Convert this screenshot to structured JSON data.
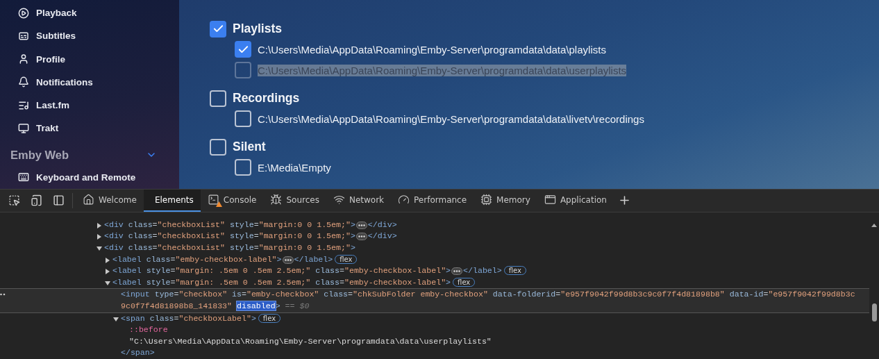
{
  "sidebar": {
    "items": [
      {
        "kind": "playback",
        "label": "Playback"
      },
      {
        "kind": "subtitles",
        "label": "Subtitles"
      },
      {
        "kind": "profile",
        "label": "Profile"
      },
      {
        "kind": "notifications",
        "label": "Notifications"
      },
      {
        "kind": "lastfm",
        "label": "Last.fm"
      },
      {
        "kind": "trakt",
        "label": "Trakt"
      }
    ],
    "section": {
      "title": "Emby Web",
      "expanded": true,
      "items": [
        {
          "kind": "keyboard",
          "label": "Keyboard and Remote"
        }
      ]
    }
  },
  "folders": [
    {
      "name": "Playlists",
      "checked": true,
      "subfolders": [
        {
          "path": "C:\\Users\\Media\\AppData\\Roaming\\Emby-Server\\programdata\\data\\playlists",
          "checked": true,
          "disabled": false,
          "highlighted": false
        },
        {
          "path": "C:\\Users\\Media\\AppData\\Roaming\\Emby-Server\\programdata\\data\\userplaylists",
          "checked": false,
          "disabled": true,
          "highlighted": true
        }
      ]
    },
    {
      "name": "Recordings",
      "checked": false,
      "subfolders": [
        {
          "path": "C:\\Users\\Media\\AppData\\Roaming\\Emby-Server\\programdata\\data\\livetv\\recordings",
          "checked": false,
          "disabled": false,
          "highlighted": false
        }
      ]
    },
    {
      "name": "Silent",
      "checked": false,
      "subfolders": [
        {
          "path": "E:\\Media\\Empty",
          "checked": false,
          "disabled": false,
          "highlighted": false
        }
      ]
    }
  ],
  "devtools": {
    "tabs": [
      {
        "kind": "welcome",
        "label": "Welcome",
        "selected": false,
        "warning": false
      },
      {
        "kind": "elements",
        "label": "Elements",
        "selected": true,
        "warning": false
      },
      {
        "kind": "console",
        "label": "Console",
        "selected": false,
        "warning": true
      },
      {
        "kind": "sources",
        "label": "Sources",
        "selected": false,
        "warning": false
      },
      {
        "kind": "network",
        "label": "Network",
        "selected": false,
        "warning": false
      },
      {
        "kind": "performance",
        "label": "Performance",
        "selected": false,
        "warning": false
      },
      {
        "kind": "memory",
        "label": "Memory",
        "selected": false,
        "warning": false
      },
      {
        "kind": "application",
        "label": "Application",
        "selected": false,
        "warning": false
      }
    ],
    "dom_tree": [
      {
        "expanded": false,
        "selected": false,
        "open": [
          {
            "kind": "tag",
            "text": "<div"
          },
          {
            "kind": "attr",
            "text": " class"
          },
          {
            "kind": "punct",
            "text": "="
          },
          {
            "kind": "value",
            "text": "\"checkboxList\""
          },
          {
            "kind": "attr",
            "text": " style"
          },
          {
            "kind": "punct",
            "text": "="
          },
          {
            "kind": "value",
            "text": "\"margin:0 0 1.5em;\""
          },
          {
            "kind": "tag",
            "text": ">"
          }
        ],
        "close": [
          {
            "kind": "tag",
            "text": "</div>"
          }
        ]
      },
      {
        "expanded": false,
        "selected": false,
        "open": [
          {
            "kind": "tag",
            "text": "<div"
          },
          {
            "kind": "attr",
            "text": " class"
          },
          {
            "kind": "punct",
            "text": "="
          },
          {
            "kind": "value",
            "text": "\"checkboxList\""
          },
          {
            "kind": "attr",
            "text": " style"
          },
          {
            "kind": "punct",
            "text": "="
          },
          {
            "kind": "value",
            "text": "\"margin:0 0 1.5em;\""
          },
          {
            "kind": "tag",
            "text": ">"
          }
        ],
        "close": [
          {
            "kind": "tag",
            "text": "</div>"
          }
        ]
      },
      {
        "expanded": true,
        "selected": false,
        "open": [
          {
            "kind": "tag",
            "text": "<div"
          },
          {
            "kind": "attr",
            "text": " class"
          },
          {
            "kind": "punct",
            "text": "="
          },
          {
            "kind": "value",
            "text": "\"checkboxList\""
          },
          {
            "kind": "attr",
            "text": " style"
          },
          {
            "kind": "punct",
            "text": "="
          },
          {
            "kind": "value",
            "text": "\"margin:0 0 1.5em;\""
          },
          {
            "kind": "tag",
            "text": ">"
          }
        ],
        "children": [
          {
            "expanded": false,
            "selected": false,
            "badge": "flex",
            "open": [
              {
                "kind": "tag",
                "text": "<label"
              },
              {
                "kind": "attr",
                "text": " class"
              },
              {
                "kind": "punct",
                "text": "="
              },
              {
                "kind": "value",
                "text": "\"emby-checkbox-label\""
              },
              {
                "kind": "tag",
                "text": ">"
              }
            ],
            "close": [
              {
                "kind": "tag",
                "text": "</label>"
              }
            ]
          },
          {
            "expanded": false,
            "selected": false,
            "badge": "flex",
            "open": [
              {
                "kind": "tag",
                "text": "<label"
              },
              {
                "kind": "attr",
                "text": " style"
              },
              {
                "kind": "punct",
                "text": "="
              },
              {
                "kind": "value",
                "text": "\"margin: .5em 0 .5em 2.5em;\""
              },
              {
                "kind": "attr",
                "text": " class"
              },
              {
                "kind": "punct",
                "text": "="
              },
              {
                "kind": "value",
                "text": "\"emby-checkbox-label\""
              },
              {
                "kind": "tag",
                "text": ">"
              }
            ],
            "close": [
              {
                "kind": "tag",
                "text": "</label>"
              }
            ]
          },
          {
            "expanded": true,
            "selected": false,
            "badge": "flex",
            "open": [
              {
                "kind": "tag",
                "text": "<label"
              },
              {
                "kind": "attr",
                "text": " style"
              },
              {
                "kind": "punct",
                "text": "="
              },
              {
                "kind": "value",
                "text": "\"margin: .5em 0 .5em 2.5em;\""
              },
              {
                "kind": "attr",
                "text": " class"
              },
              {
                "kind": "punct",
                "text": "="
              },
              {
                "kind": "value",
                "text": "\"emby-checkbox-label\""
              },
              {
                "kind": "tag",
                "text": ">"
              }
            ],
            "children": [
              {
                "selected": true,
                "open": [
                  {
                    "kind": "tag",
                    "text": "<input"
                  },
                  {
                    "kind": "attr",
                    "text": " type"
                  },
                  {
                    "kind": "punct",
                    "text": "="
                  },
                  {
                    "kind": "value",
                    "text": "\"checkbox\""
                  },
                  {
                    "kind": "attr",
                    "text": " is"
                  },
                  {
                    "kind": "punct",
                    "text": "="
                  },
                  {
                    "kind": "value",
                    "text": "\"emby-checkbox\""
                  },
                  {
                    "kind": "attr",
                    "text": " class"
                  },
                  {
                    "kind": "punct",
                    "text": "="
                  },
                  {
                    "kind": "value",
                    "text": "\"chkSubFolder emby-checkbox\""
                  },
                  {
                    "kind": "attr",
                    "text": " data-folderid"
                  },
                  {
                    "kind": "punct",
                    "text": "="
                  },
                  {
                    "kind": "value",
                    "text": "\"e957f9042f99d8b3c9c0f7f4d81898b8\""
                  },
                  {
                    "kind": "attr",
                    "text": " data-id"
                  },
                  {
                    "kind": "punct",
                    "text": "="
                  },
                  {
                    "kind": "value",
                    "text": "\"e957f9042f99d8b3c9c0f7f4d81898b8_141833\" "
                  },
                  {
                    "kind": "match",
                    "text": "disabled"
                  },
                  {
                    "kind": "tag",
                    "text": ">"
                  },
                  {
                    "kind": "note",
                    "text": " == $0"
                  }
                ]
              },
              {
                "expanded": true,
                "selected": false,
                "badge": "flex",
                "open": [
                  {
                    "kind": "tag",
                    "text": "<span"
                  },
                  {
                    "kind": "attr",
                    "text": " class"
                  },
                  {
                    "kind": "punct",
                    "text": "="
                  },
                  {
                    "kind": "value",
                    "text": "\"checkboxLabel\""
                  },
                  {
                    "kind": "tag",
                    "text": ">"
                  }
                ],
                "children": [
                  {
                    "selected": false,
                    "open": [
                      {
                        "kind": "pseudo",
                        "text": "::before"
                      }
                    ]
                  },
                  {
                    "selected": false,
                    "open": [
                      {
                        "kind": "text",
                        "text": "\"C:\\Users\\Media\\AppData\\Roaming\\Emby-Server\\programdata\\data\\userplaylists\""
                      }
                    ]
                  }
                ],
                "close": [
                  {
                    "kind": "tag",
                    "text": "</span>"
                  }
                ]
              }
            ]
          }
        ]
      }
    ]
  }
}
